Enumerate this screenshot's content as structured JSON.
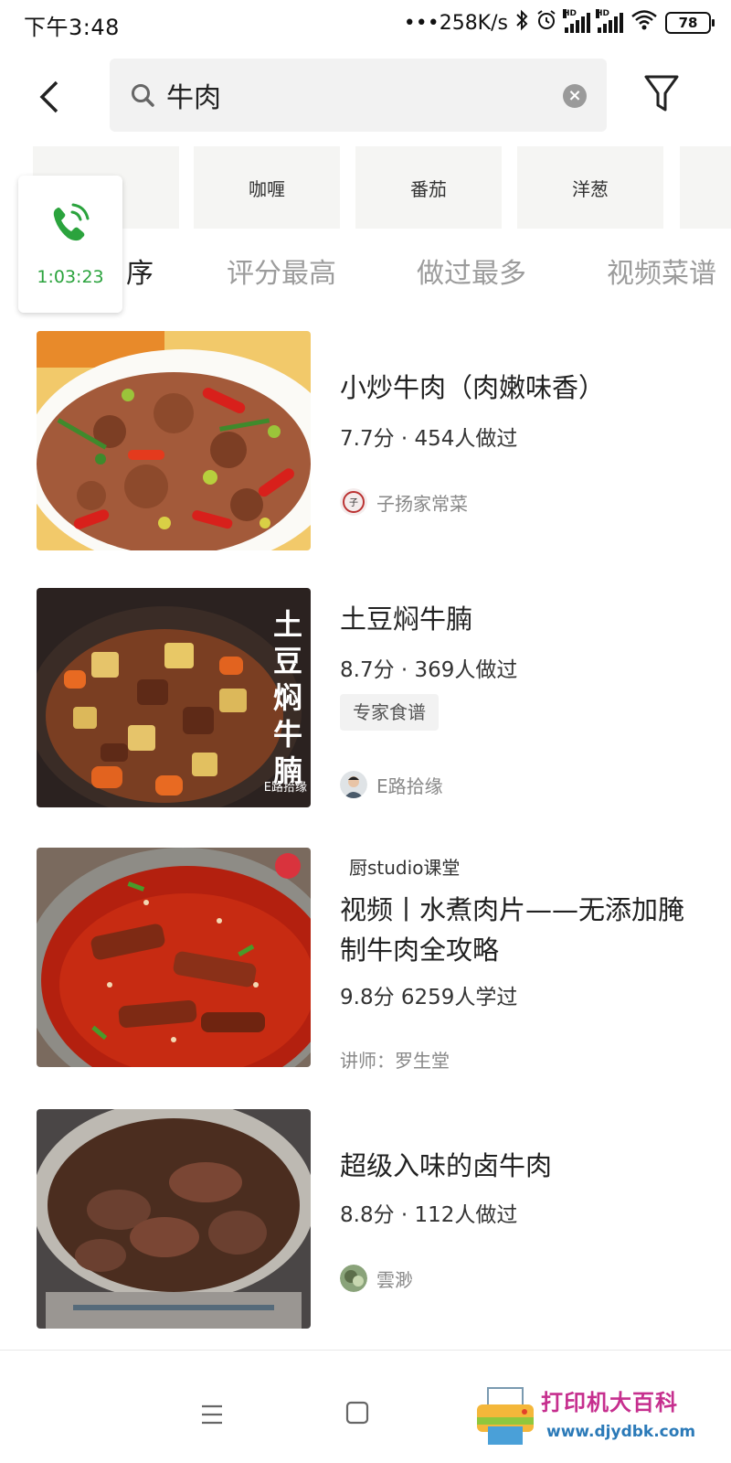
{
  "status_bar": {
    "time": "下午3:48",
    "network_speed": "•••258K/s",
    "hd1": "HD",
    "hd2": "HD",
    "battery": "78"
  },
  "search": {
    "query": "牛肉"
  },
  "chips": [
    "咖喱",
    "番茄",
    "洋葱"
  ],
  "sort_tabs": [
    {
      "label": "序",
      "active": true
    },
    {
      "label": "评分最高",
      "active": false
    },
    {
      "label": "做过最多",
      "active": false
    },
    {
      "label": "视频菜谱",
      "active": false
    }
  ],
  "call": {
    "duration": "1:03:23",
    "color": "#2ba33d"
  },
  "recipes": [
    {
      "title": "小炒牛肉（肉嫩味香）",
      "meta": "7.7分 · 454人做过",
      "author": "子扬家常菜"
    },
    {
      "title": "土豆焖牛腩",
      "meta": "8.7分 · 369人做过",
      "badge": "专家食谱",
      "author": "E路拾缘",
      "overlay": "土豆焖牛腩",
      "overlay_sign": "E路拾缘"
    },
    {
      "tag": "厨studio课堂",
      "title": "视频丨水煮肉片——无添加腌制牛肉全攻略",
      "meta": "9.8分 6259人学过",
      "author": "讲师：罗生堂"
    },
    {
      "title": "超级入味的卤牛肉",
      "meta": "8.8分 · 112人做过",
      "author": "雲渺"
    }
  ],
  "watermark": {
    "text": "打印机大百科",
    "url": "www.djydbk.com"
  },
  "colors": {
    "accent_green": "#2ba33d",
    "muted_text": "#9c9c9c"
  }
}
